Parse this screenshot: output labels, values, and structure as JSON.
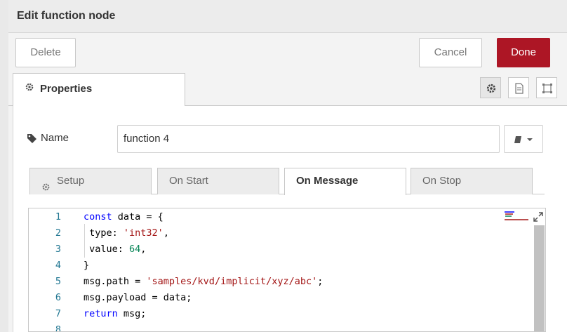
{
  "dialog": {
    "title": "Edit function node"
  },
  "toolbar": {
    "delete_label": "Delete",
    "cancel_label": "Cancel",
    "done_label": "Done",
    "done_color": "#ad1625"
  },
  "tabs": {
    "properties_label": "Properties"
  },
  "side_icons": [
    "gear-icon",
    "description-icon",
    "appearance-icon"
  ],
  "name_field": {
    "label": "Name",
    "value": "function 4"
  },
  "subtabs": [
    {
      "label": "Setup",
      "active": false
    },
    {
      "label": "On Start",
      "active": false
    },
    {
      "label": "On Message",
      "active": true
    },
    {
      "label": "On Stop",
      "active": false
    }
  ],
  "editor": {
    "line_numbers": [
      "1",
      "2",
      "3",
      "4",
      "5",
      "6",
      "7",
      "8"
    ],
    "lines": [
      [
        {
          "t": "const",
          "c": "kw"
        },
        {
          "t": " data = {",
          "c": ""
        }
      ],
      [
        {
          "t": " type: ",
          "c": ""
        },
        {
          "t": "'int32'",
          "c": "str"
        },
        {
          "t": ",",
          "c": ""
        }
      ],
      [
        {
          "t": " value: ",
          "c": ""
        },
        {
          "t": "64",
          "c": "num"
        },
        {
          "t": ",",
          "c": ""
        }
      ],
      [
        {
          "t": "}",
          "c": ""
        }
      ],
      [
        {
          "t": "msg.path = ",
          "c": ""
        },
        {
          "t": "'samples/kvd/implicit/xyz/abc'",
          "c": "str"
        },
        {
          "t": ";",
          "c": ""
        }
      ],
      [
        {
          "t": "msg.payload = data;",
          "c": ""
        }
      ],
      [
        {
          "t": "return",
          "c": "kw"
        },
        {
          "t": " msg;",
          "c": ""
        }
      ],
      [
        {
          "t": "",
          "c": ""
        }
      ]
    ]
  }
}
